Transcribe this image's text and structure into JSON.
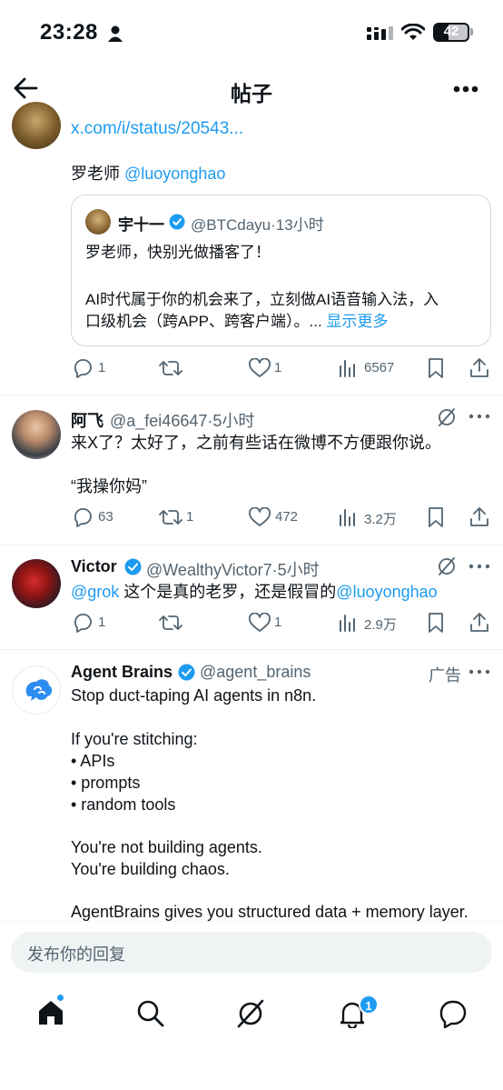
{
  "status_bar": {
    "time": "23:28",
    "battery": "42"
  },
  "header": {
    "title": "帖子"
  },
  "post_tail": {
    "link": "x.com/i/status/20543...",
    "reply_prefix": "罗老师",
    "reply_mention": "@luoyonghao",
    "quote": {
      "name": "宇十一",
      "handle": "@BTCdayu",
      "sep": "·",
      "time": "13小时",
      "line1": "罗老师，快别光做播客了！",
      "line2": "AI时代属于你的机会来了，立刻做AI语音输入法，入",
      "line3": "口级机会（跨APP、跨客户端）。...",
      "show_more": "显示更多"
    },
    "actions": {
      "replies": "1",
      "reposts": "",
      "likes": "1",
      "views": "6567"
    }
  },
  "tweets": [
    {
      "name": "阿飞",
      "handle": "@a_fei46647",
      "sep": "·",
      "time": "5小时",
      "line1": "来X了？太好了，之前有些话在微博不方便跟你说。",
      "line2": "“我操你妈”",
      "actions": {
        "replies": "63",
        "reposts": "1",
        "likes": "472",
        "views": "3.2万"
      }
    },
    {
      "name": "Victor",
      "handle": "@WealthyVictor7",
      "sep": "·",
      "time": "5小时",
      "mention1": "@grok",
      "text_mid": " 这个是真的老罗，还是假冒的",
      "mention2": "@luoyonghao",
      "actions": {
        "replies": "1",
        "reposts": "",
        "likes": "1",
        "views": "2.9万"
      }
    }
  ],
  "ad": {
    "name": "Agent Brains",
    "handle": "@agent_brains",
    "ad_label": "广告",
    "lines": [
      "Stop duct-taping AI agents in n8n.",
      "If you're stitching:",
      "• APIs",
      "• prompts",
      "• random tools",
      "You're not building agents.",
      "You're building chaos.",
      "AgentBrains gives you structured data + memory layer."
    ]
  },
  "reply": {
    "placeholder": "发布你的回复"
  },
  "nav": {
    "notifications_badge": "1"
  },
  "colors": {
    "accent": "#1d9bf0",
    "text": "#0f1419",
    "muted": "#536471",
    "divider": "#eff3f4"
  }
}
